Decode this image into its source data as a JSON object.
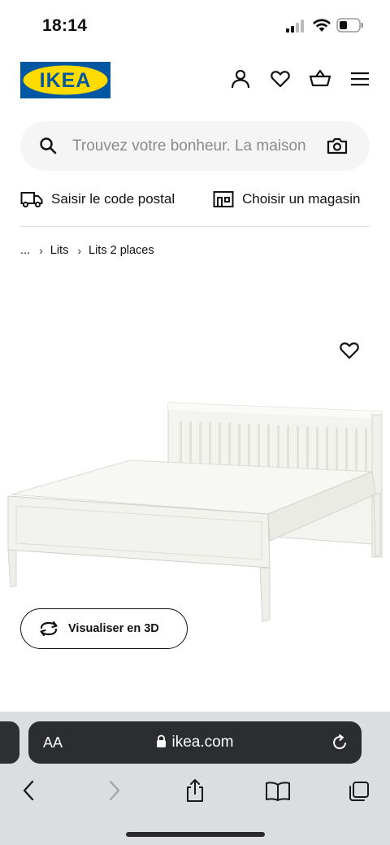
{
  "status_bar": {
    "time": "18:14"
  },
  "header": {
    "logo_text": "IKEA",
    "brand_colors": {
      "blue": "#0058a3",
      "yellow": "#ffdb00"
    },
    "icons": [
      "account-icon",
      "heart-icon",
      "cart-icon",
      "menu-icon"
    ]
  },
  "search": {
    "placeholder": "Trouvez votre bonheur. La maison"
  },
  "shortcuts": {
    "postal_code": "Saisir le code postal",
    "store": "Choisir un magasin"
  },
  "breadcrumb": {
    "items": [
      "...",
      "Lits",
      "Lits 2 places"
    ]
  },
  "product": {
    "visualize_3d_label": "Visualiser en 3D"
  },
  "browser": {
    "text_size_label": "AA",
    "url": "ikea.com"
  }
}
